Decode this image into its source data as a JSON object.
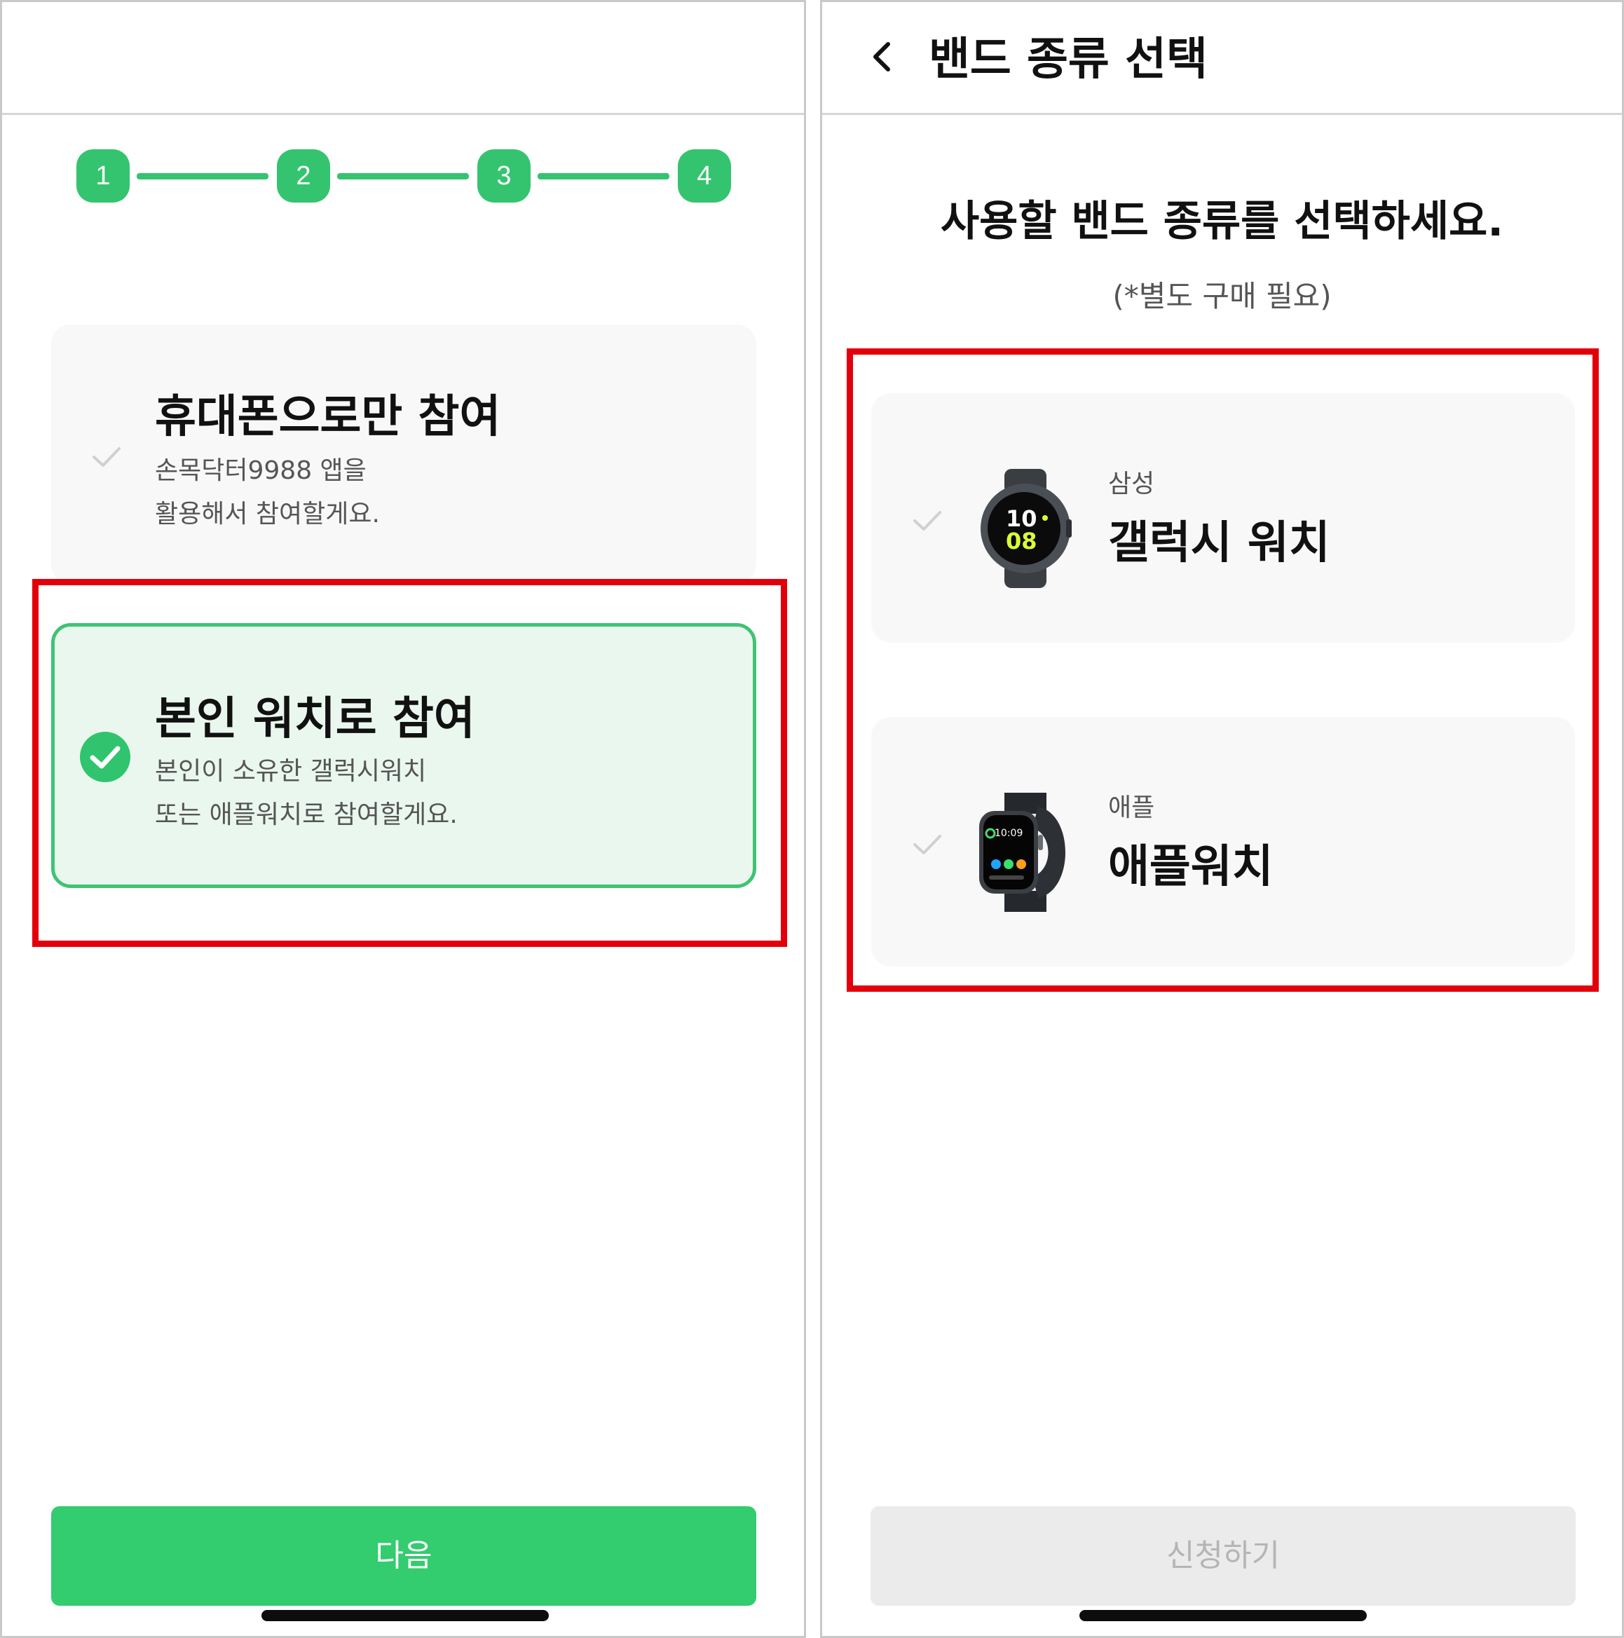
{
  "left_screen": {
    "steps": [
      "1",
      "2",
      "3",
      "4"
    ],
    "options": [
      {
        "title": "휴대폰으로만 참여",
        "desc_line1": "손목닥터9988 앱을",
        "desc_line2": "활용해서 참여할게요.",
        "selected": false
      },
      {
        "title": "본인 워치로 참여",
        "desc_line1": "본인이 소유한 갤럭시워치",
        "desc_line2": "또는 애플워치로 참여할게요.",
        "selected": true
      }
    ],
    "next_button": "다음"
  },
  "right_screen": {
    "header_title": "밴드 종류 선택",
    "heading": "사용할 밴드 종류를 선택하세요.",
    "subheading": "(*별도 구매 필요)",
    "options": [
      {
        "brand": "삼성",
        "name": "갤럭시 워치",
        "watch_face_hour": "10",
        "watch_face_minute": "08",
        "selected": false
      },
      {
        "brand": "애플",
        "name": "애플워치",
        "watch_face_time": "10:09",
        "selected": false
      }
    ],
    "apply_button": "신청하기"
  },
  "colors": {
    "accent_green": "#33cc6f",
    "selected_bg": "#eaf7ef",
    "highlight_red": "#e3000b",
    "disabled_bg": "#ebebeb",
    "disabled_text": "#b5b5b5"
  }
}
